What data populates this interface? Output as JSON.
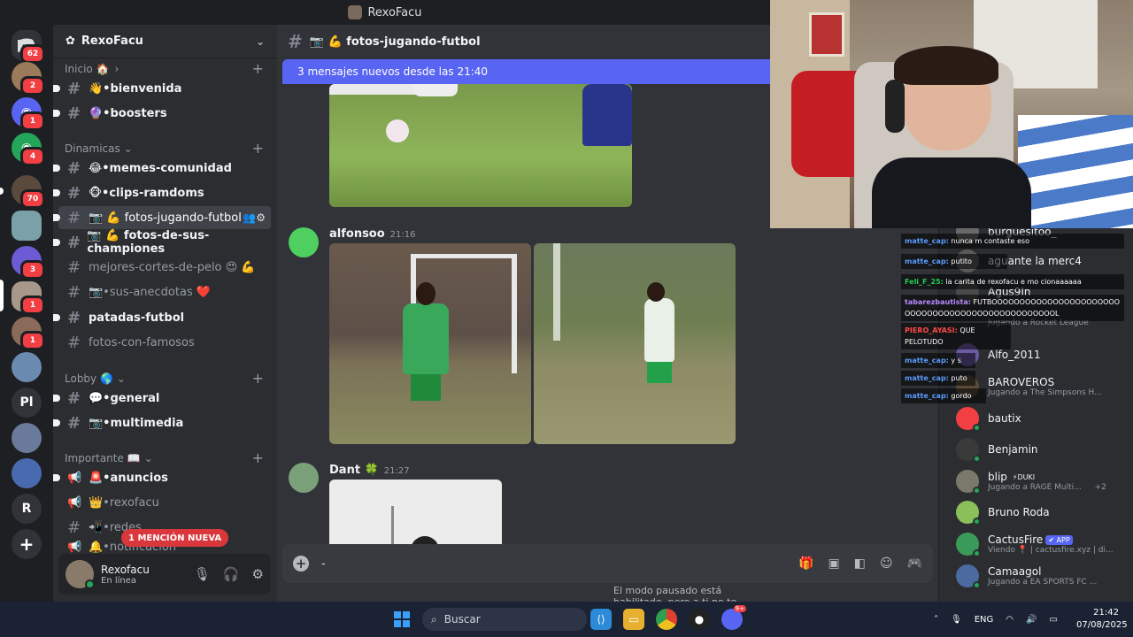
{
  "window": {
    "title": "RexoFacu"
  },
  "guilds": {
    "badges": [
      "62",
      "2",
      "1",
      "4",
      "70",
      "",
      "3",
      "1",
      "1",
      "",
      ""
    ],
    "text_icons": [
      "Pl",
      "R"
    ]
  },
  "server": {
    "name": "RexoFacu"
  },
  "categories": {
    "inicio": "Inicio 🏠",
    "dinamicas": "Dinamicas",
    "lobby": "Lobby 🌎",
    "importante": "Importante 📖"
  },
  "channels": [
    {
      "name": "👋•bienvenida"
    },
    {
      "name": "🔮•boosters"
    },
    {
      "name": "😂•memes-comunidad"
    },
    {
      "name": "🐵•clips-ramdoms"
    },
    {
      "name": "📷 💪 fotos-jugando-futbol"
    },
    {
      "name": "📷 💪 fotos-de-sus-championes"
    },
    {
      "name": "mejores-cortes-de-pelo 😍 💪"
    },
    {
      "name": "📷•sus-anecdotas ❤️"
    },
    {
      "name": "patadas-futbol"
    },
    {
      "name": "fotos-con-famosos"
    },
    {
      "name": "💬•general"
    },
    {
      "name": "📷•multimedia"
    },
    {
      "name": "🚨•anuncios"
    },
    {
      "name": "👑•rexofacu"
    },
    {
      "name": "📲•redes"
    },
    {
      "name": "🔔•notificación"
    }
  ],
  "mention_badge": "1 MENCIÓN NUEVA",
  "user": {
    "name": "Rexofacu",
    "status": "En línea"
  },
  "current_channel": {
    "name": "📷 💪 fotos-jugando-futbol"
  },
  "new_messages_bar": "3 mensajes nuevos desde las 21:40",
  "messages": [
    {
      "author": "alfonsoo",
      "time": "21:16"
    },
    {
      "author": "Dant 🍀",
      "time": "21:27"
    }
  ],
  "composer": {
    "value": "-"
  },
  "slowmode_notice": "El modo pausado está habilitado, pero a ti no te afecta. ¡Increíble!",
  "members": [
    {
      "name": "burguesitoo_",
      "sub": ""
    },
    {
      "name": "aguante la merc4",
      "sub": ""
    },
    {
      "name": "Agus9In",
      "sub": ""
    },
    {
      "name": "",
      "sub": "Jugando a Rocket League"
    },
    {
      "name": "Alfo_2011",
      "sub": ""
    },
    {
      "name": "BAROVEROS",
      "sub": "Jugando a The Simpsons H..."
    },
    {
      "name": "bautix",
      "sub": ""
    },
    {
      "name": "Benjamin",
      "sub": ""
    },
    {
      "name": "blip",
      "tag": "⚡DUKI",
      "sub": "Jugando a RAGE Multi...",
      "extra": "+2"
    },
    {
      "name": "Bruno Roda",
      "sub": ""
    },
    {
      "name": "CactusFire",
      "tag": "✔ APP",
      "sub": "Viendo 📍 | cactusfire.xyz | di..."
    },
    {
      "name": "Camaagol",
      "sub": "Jugando a EA SPORTS FC ..."
    }
  ],
  "stream_chat": [
    {
      "user": "matte_cap:",
      "text": "nunca m contaste eso"
    },
    {
      "user": "matte_cap:",
      "text": "putito"
    },
    {
      "user": "Feli_F_25:",
      "text": "la carita de rexofacu e mo cionaaaaaa"
    },
    {
      "user": "tabarezbautista:",
      "text": "FUTBOOOOOOOOOOOOOOOOOOOOOOOOOOOOOOOOOOOOOOOOOOOOOOOOOOL"
    },
    {
      "user": "PIERO_AYASI:",
      "text": "QUE PELOTUDO"
    },
    {
      "user": "matte_cap:",
      "text": "y s"
    },
    {
      "user": "matte_cap:",
      "text": "puto"
    },
    {
      "user": "matte_cap:",
      "text": "gordo"
    }
  ],
  "taskbar": {
    "search_placeholder": "Buscar",
    "lang": "ENG",
    "time": "21:42",
    "date": "07/08/2025",
    "discord_badge": "9+"
  },
  "colors": {
    "blurple": "#5865f2",
    "online": "#23a55a",
    "mention": "#da373c"
  }
}
